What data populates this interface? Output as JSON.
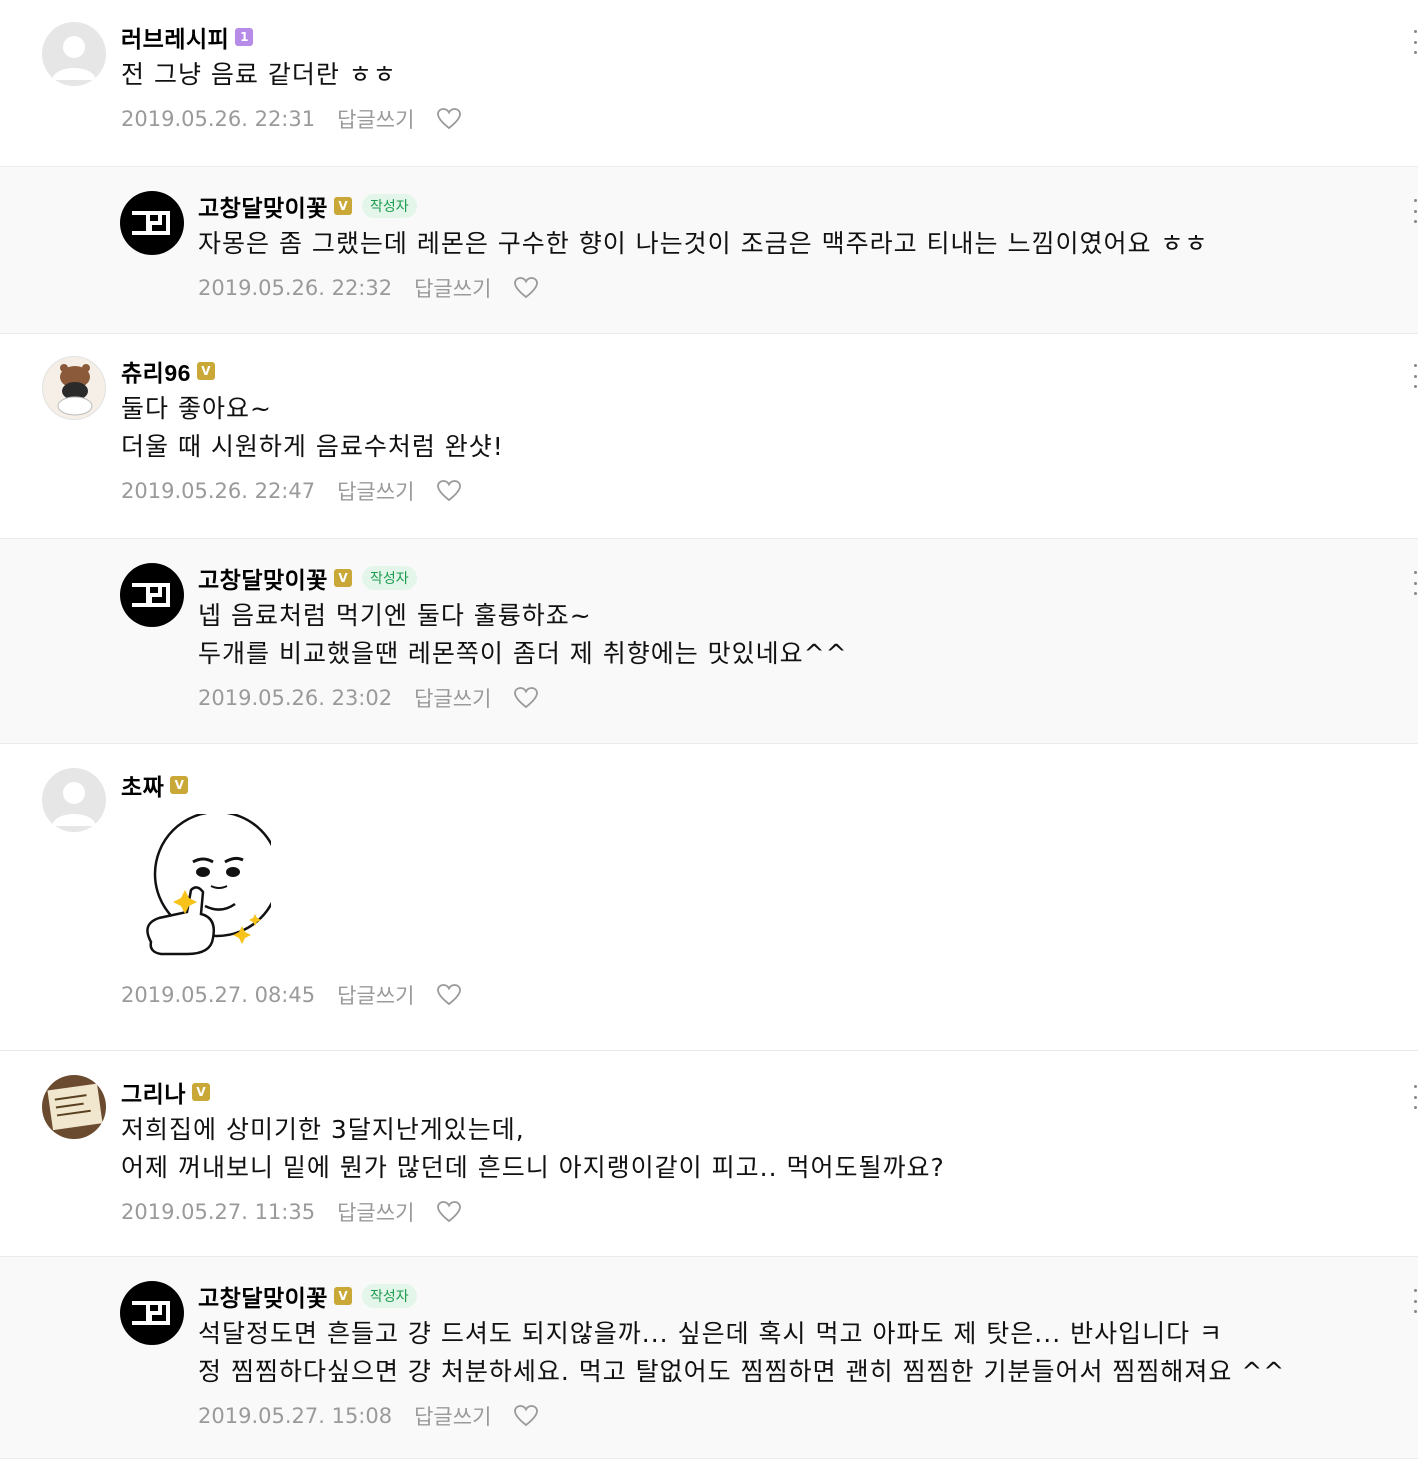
{
  "comments": [
    {
      "nickname": "러브레시피",
      "badge": "1",
      "text": "전 그냥 음료 같더란 ㅎㅎ",
      "date": "2019.05.26. 22:31",
      "reply_label": "답글쓰기"
    },
    {
      "nickname": "고창달맞이꽃",
      "badge": "V",
      "author_tag": "작성자",
      "text": "자몽은 좀 그랬는데 레몬은 구수한 향이 나는것이 조금은 맥주라고 티내는 느낌이였어요 ㅎㅎ",
      "date": "2019.05.26. 22:32",
      "reply_label": "답글쓰기"
    },
    {
      "nickname": "츄리96",
      "badge": "V",
      "text_lines": [
        "둘다 좋아요~",
        "더울 때 시원하게 음료수처럼 완샷!"
      ],
      "date": "2019.05.26. 22:47",
      "reply_label": "답글쓰기"
    },
    {
      "nickname": "고창달맞이꽃",
      "badge": "V",
      "author_tag": "작성자",
      "text_lines": [
        "넵 음료처럼 먹기엔 둘다 훌륭하죠~",
        "두개를 비교했을땐 레몬쪽이 좀더 제 취향에는 맛있네요^^"
      ],
      "date": "2019.05.26. 23:02",
      "reply_label": "답글쓰기"
    },
    {
      "nickname": "초짜",
      "badge": "V",
      "sticker": "thumbs-up-face-sticker",
      "date": "2019.05.27. 08:45",
      "reply_label": "답글쓰기"
    },
    {
      "nickname": "그리나",
      "badge": "V",
      "text_lines": [
        "저희집에 상미기한 3달지난게있는데,",
        "어제 꺼내보니 밑에 뭔가 많던데 흔드니 아지랭이같이 피고.. 먹어도될까요?"
      ],
      "date": "2019.05.27. 11:35",
      "reply_label": "답글쓰기"
    },
    {
      "nickname": "고창달맞이꽃",
      "badge": "V",
      "author_tag": "작성자",
      "text_lines": [
        "석달정도면 흔들고 걍 드셔도 되지않을까... 싶은데 혹시 먹고 아파도 제 탓은... 반사입니다 ㅋ",
        "정 찜찜하다싶으면 걍 처분하세요. 먹고 탈없어도 찜찜하면 괜히 찜찜한 기분들어서 찜찜해져요 ^^"
      ],
      "date": "2019.05.27. 15:08",
      "reply_label": "답글쓰기"
    }
  ],
  "colors": {
    "author_tag_bg": "#e4f6ea",
    "author_tag_text": "#1c9c4f",
    "level_badge": "#b78be8",
    "verified_badge": "#c9a838",
    "meta_text": "#9a9a9a"
  },
  "icons": {
    "heart": "heart-outline-icon",
    "more": "more-vertical-icon"
  }
}
